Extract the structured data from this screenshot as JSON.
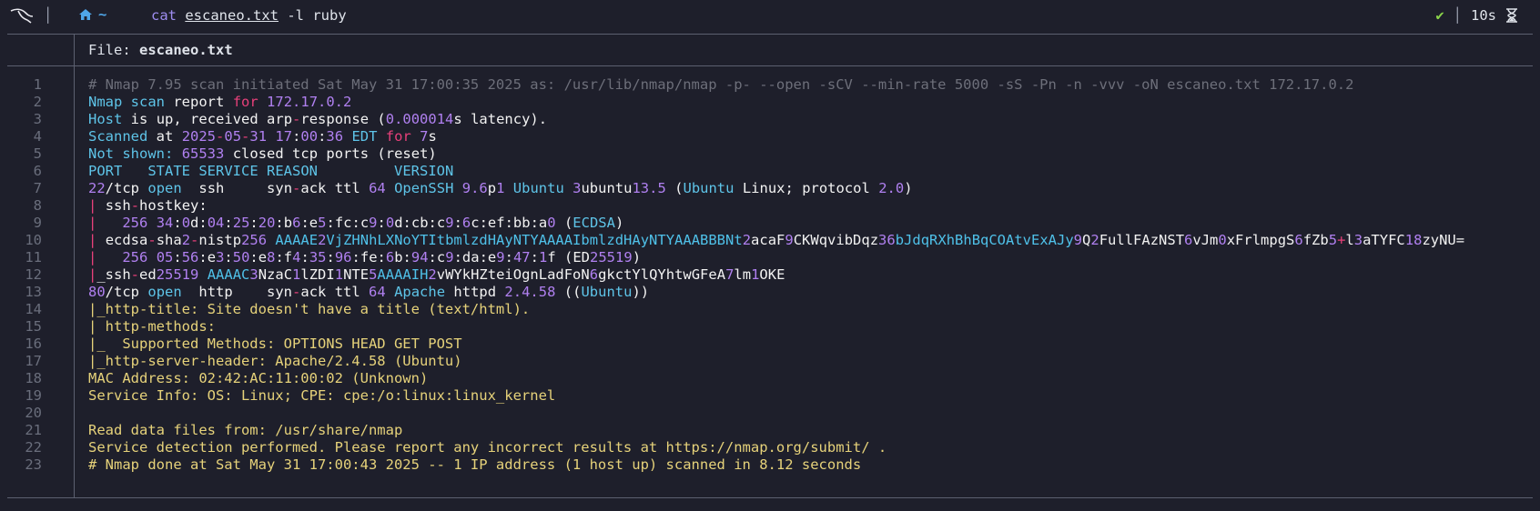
{
  "prompt": {
    "command": "cat",
    "file": "escaneo.txt",
    "args": "-l ruby",
    "home_symbol": "~",
    "status_ok": "✔",
    "elapsed": "10s"
  },
  "header": {
    "label": "File: ",
    "filename": "escaneo.txt"
  },
  "lines": [
    {
      "n": "1",
      "t": "# Nmap 7.95 scan initiated Sat May 31 17:00:35 2025 as: /usr/lib/nmap/nmap -p- --open -sCV --min-rate 5000 -sS -Pn -n -vvv -oN escaneo.txt 172.17.0.2"
    },
    {
      "n": "2",
      "t": "Nmap scan report for 172.17.0.2"
    },
    {
      "n": "3",
      "t": "Host is up, received arp-response (0.000014s latency)."
    },
    {
      "n": "4",
      "t": "Scanned at 2025-05-31 17:00:36 EDT for 7s"
    },
    {
      "n": "5",
      "t": "Not shown: 65533 closed tcp ports (reset)"
    },
    {
      "n": "6",
      "t": "PORT   STATE SERVICE REASON         VERSION"
    },
    {
      "n": "7",
      "t": "22/tcp open  ssh     syn-ack ttl 64 OpenSSH 9.6p1 Ubuntu 3ubuntu13.5 (Ubuntu Linux; protocol 2.0)"
    },
    {
      "n": "8",
      "t": "| ssh-hostkey:"
    },
    {
      "n": "9",
      "t": "|   256 34:0d:04:25:20:b6:e5:fc:c9:0d:cb:c9:6c:ef:bb:a0 (ECDSA)"
    },
    {
      "n": "10",
      "t": "| ecdsa-sha2-nistp256 AAAAE2VjZHNhLXNoYTItbmlzdHAyNTYAAAAIbmlzdHAyNTYAAABBBNt2acaF9CKWqvibDqz36bJdqRXhBhBqCOAtvExAJy9Q2FullFAzNST6vJm0xFrlmpgS6fZb5+l3aTYFC18zyNU="
    },
    {
      "n": "11",
      "t": "|   256 05:56:e3:50:e8:f4:35:96:fe:6b:94:c9:da:e9:47:1f (ED25519)"
    },
    {
      "n": "12",
      "t": "|_ssh-ed25519 AAAAC3NzaC1lZDI1NTE5AAAAIH2vWYkHZteiOgnLadFoN6gkctYlQYhtwGFeA7lm1OKE"
    },
    {
      "n": "13",
      "t": "80/tcp open  http    syn-ack ttl 64 Apache httpd 2.4.58 ((Ubuntu))"
    },
    {
      "n": "14",
      "t": "|_http-title: Site doesn't have a title (text/html)."
    },
    {
      "n": "15",
      "t": "| http-methods:"
    },
    {
      "n": "16",
      "t": "|_  Supported Methods: OPTIONS HEAD GET POST"
    },
    {
      "n": "17",
      "t": "|_http-server-header: Apache/2.4.58 (Ubuntu)"
    },
    {
      "n": "18",
      "t": "MAC Address: 02:42:AC:11:00:02 (Unknown)"
    },
    {
      "n": "19",
      "t": "Service Info: OS: Linux; CPE: cpe:/o:linux:linux_kernel"
    },
    {
      "n": "20",
      "t": ""
    },
    {
      "n": "21",
      "t": "Read data files from: /usr/share/nmap"
    },
    {
      "n": "22",
      "t": "Service detection performed. Please report any incorrect results at https://nmap.org/submit/ ."
    },
    {
      "n": "23",
      "t": "# Nmap done at Sat May 31 17:00:43 2025 -- 1 IP address (1 host up) scanned in 8.12 seconds"
    }
  ],
  "colors": {
    "background": "#1e1f2b",
    "comment": "#6d6f7a",
    "keyword_blue": "#5ec4e8",
    "keyword_pink": "#e8407a",
    "number_purple": "#b080f0",
    "string_yellow": "#e6d27a",
    "ok_green": "#8ad34a"
  },
  "icons": [
    "kali-dragon-icon",
    "home-icon",
    "check-icon",
    "hourglass-icon"
  ]
}
